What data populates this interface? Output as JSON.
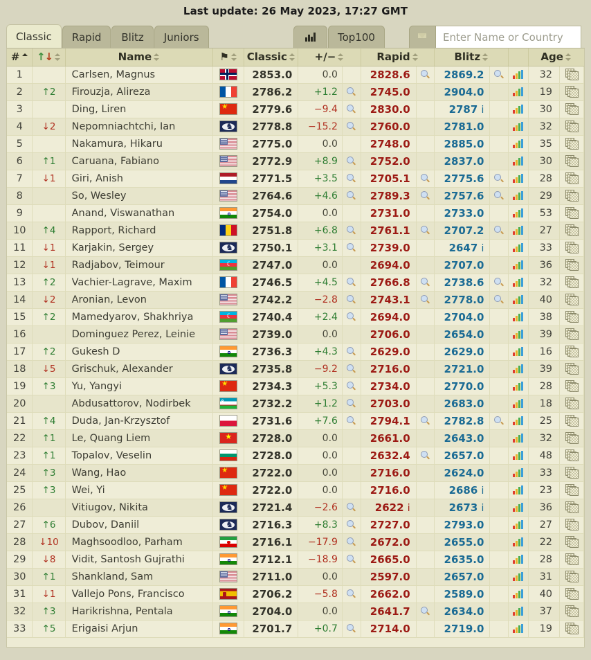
{
  "header": {
    "last_update": "Last update: 26 May 2023, 17:27 GMT"
  },
  "toolbar": {
    "tabs": [
      {
        "label": "Classic",
        "active": true
      },
      {
        "label": "Rapid",
        "active": false
      },
      {
        "label": "Blitz",
        "active": false
      },
      {
        "label": "Juniors",
        "active": false
      }
    ],
    "chart_button_icon": "bar-chart-icon",
    "top100_label": "Top100",
    "filter_icon": "funnel-icon",
    "search": {
      "value": "",
      "placeholder": "Enter Name or Country"
    }
  },
  "table": {
    "columns": [
      {
        "key": "rank",
        "label": "#",
        "sorted": "asc"
      },
      {
        "key": "change",
        "label": "↑↓"
      },
      {
        "key": "name",
        "label": "Name"
      },
      {
        "key": "flag",
        "label": "flag-icon"
      },
      {
        "key": "classic",
        "label": "Classic"
      },
      {
        "key": "diff",
        "label": "+/−"
      },
      {
        "key": "rapid",
        "label": "Rapid"
      },
      {
        "key": "blitz",
        "label": "Blitz"
      },
      {
        "key": "age",
        "label": "Age"
      }
    ],
    "rows": [
      {
        "rank": "1",
        "change": "",
        "dir": "",
        "name": "Carlsen, Magnus",
        "flag": "NOR",
        "classic": "2853.0",
        "diff": "0.0",
        "diff_sign": "zero",
        "classic_mag": false,
        "rapid": "2828.6",
        "rapid_i": false,
        "rapid_mag": true,
        "blitz": "2869.2",
        "blitz_i": false,
        "blitz_mag": true,
        "age": "32"
      },
      {
        "rank": "2",
        "change": "2",
        "dir": "up",
        "name": "Firouzja, Alireza",
        "flag": "FRA",
        "classic": "2786.2",
        "diff": "+1.2",
        "diff_sign": "pos",
        "classic_mag": true,
        "rapid": "2745.0",
        "rapid_i": false,
        "rapid_mag": false,
        "blitz": "2904.0",
        "blitz_i": false,
        "blitz_mag": false,
        "age": "19"
      },
      {
        "rank": "3",
        "change": "",
        "dir": "",
        "name": "Ding, Liren",
        "flag": "CHN",
        "classic": "2779.6",
        "diff": "−9.4",
        "diff_sign": "neg",
        "classic_mag": true,
        "rapid": "2830.0",
        "rapid_i": false,
        "rapid_mag": false,
        "blitz": "2787",
        "blitz_i": true,
        "blitz_mag": false,
        "age": "30"
      },
      {
        "rank": "4",
        "change": "2",
        "dir": "down",
        "name": "Nepomniachtchi, Ian",
        "flag": "FID",
        "classic": "2778.8",
        "diff": "−15.2",
        "diff_sign": "neg",
        "classic_mag": true,
        "rapid": "2760.0",
        "rapid_i": false,
        "rapid_mag": false,
        "blitz": "2781.0",
        "blitz_i": false,
        "blitz_mag": false,
        "age": "32"
      },
      {
        "rank": "5",
        "change": "",
        "dir": "",
        "name": "Nakamura, Hikaru",
        "flag": "USA",
        "classic": "2775.0",
        "diff": "0.0",
        "diff_sign": "zero",
        "classic_mag": false,
        "rapid": "2748.0",
        "rapid_i": false,
        "rapid_mag": false,
        "blitz": "2885.0",
        "blitz_i": false,
        "blitz_mag": false,
        "age": "35"
      },
      {
        "rank": "6",
        "change": "1",
        "dir": "up",
        "name": "Caruana, Fabiano",
        "flag": "USA",
        "classic": "2772.9",
        "diff": "+8.9",
        "diff_sign": "pos",
        "classic_mag": true,
        "rapid": "2752.0",
        "rapid_i": false,
        "rapid_mag": false,
        "blitz": "2837.0",
        "blitz_i": false,
        "blitz_mag": false,
        "age": "30"
      },
      {
        "rank": "7",
        "change": "1",
        "dir": "down",
        "name": "Giri, Anish",
        "flag": "NED",
        "classic": "2771.5",
        "diff": "+3.5",
        "diff_sign": "pos",
        "classic_mag": true,
        "rapid": "2705.1",
        "rapid_i": false,
        "rapid_mag": true,
        "blitz": "2775.6",
        "blitz_i": false,
        "blitz_mag": true,
        "age": "28"
      },
      {
        "rank": "8",
        "change": "",
        "dir": "",
        "name": "So, Wesley",
        "flag": "USA",
        "classic": "2764.6",
        "diff": "+4.6",
        "diff_sign": "pos",
        "classic_mag": true,
        "rapid": "2789.3",
        "rapid_i": false,
        "rapid_mag": true,
        "blitz": "2757.6",
        "blitz_i": false,
        "blitz_mag": true,
        "age": "29"
      },
      {
        "rank": "9",
        "change": "",
        "dir": "",
        "name": "Anand, Viswanathan",
        "flag": "IND",
        "classic": "2754.0",
        "diff": "0.0",
        "diff_sign": "zero",
        "classic_mag": false,
        "rapid": "2731.0",
        "rapid_i": false,
        "rapid_mag": false,
        "blitz": "2733.0",
        "blitz_i": false,
        "blitz_mag": false,
        "age": "53"
      },
      {
        "rank": "10",
        "change": "4",
        "dir": "up",
        "name": "Rapport, Richard",
        "flag": "ROU",
        "classic": "2751.8",
        "diff": "+6.8",
        "diff_sign": "pos",
        "classic_mag": true,
        "rapid": "2761.1",
        "rapid_i": false,
        "rapid_mag": true,
        "blitz": "2707.2",
        "blitz_i": false,
        "blitz_mag": true,
        "age": "27"
      },
      {
        "rank": "11",
        "change": "1",
        "dir": "down",
        "name": "Karjakin, Sergey",
        "flag": "FID",
        "classic": "2750.1",
        "diff": "+3.1",
        "diff_sign": "pos",
        "classic_mag": true,
        "rapid": "2739.0",
        "rapid_i": false,
        "rapid_mag": false,
        "blitz": "2647",
        "blitz_i": true,
        "blitz_mag": false,
        "age": "33"
      },
      {
        "rank": "12",
        "change": "1",
        "dir": "down",
        "name": "Radjabov, Teimour",
        "flag": "AZE",
        "classic": "2747.0",
        "diff": "0.0",
        "diff_sign": "zero",
        "classic_mag": false,
        "rapid": "2694.0",
        "rapid_i": false,
        "rapid_mag": false,
        "blitz": "2707.0",
        "blitz_i": false,
        "blitz_mag": false,
        "age": "36"
      },
      {
        "rank": "13",
        "change": "2",
        "dir": "up",
        "name": "Vachier-Lagrave, Maxim",
        "flag": "FRA",
        "classic": "2746.5",
        "diff": "+4.5",
        "diff_sign": "pos",
        "classic_mag": true,
        "rapid": "2766.8",
        "rapid_i": false,
        "rapid_mag": true,
        "blitz": "2738.6",
        "blitz_i": false,
        "blitz_mag": true,
        "age": "32"
      },
      {
        "rank": "14",
        "change": "2",
        "dir": "down",
        "name": "Aronian, Levon",
        "flag": "USA",
        "classic": "2742.2",
        "diff": "−2.8",
        "diff_sign": "neg",
        "classic_mag": true,
        "rapid": "2743.1",
        "rapid_i": false,
        "rapid_mag": true,
        "blitz": "2778.0",
        "blitz_i": false,
        "blitz_mag": true,
        "age": "40"
      },
      {
        "rank": "15",
        "change": "2",
        "dir": "up",
        "name": "Mamedyarov, Shakhriya",
        "flag": "AZE",
        "classic": "2740.4",
        "diff": "+2.4",
        "diff_sign": "pos",
        "classic_mag": true,
        "rapid": "2694.0",
        "rapid_i": false,
        "rapid_mag": false,
        "blitz": "2704.0",
        "blitz_i": false,
        "blitz_mag": false,
        "age": "38"
      },
      {
        "rank": "16",
        "change": "",
        "dir": "",
        "name": "Dominguez Perez, Leinie",
        "flag": "USA",
        "classic": "2739.0",
        "diff": "0.0",
        "diff_sign": "zero",
        "classic_mag": false,
        "rapid": "2706.0",
        "rapid_i": false,
        "rapid_mag": false,
        "blitz": "2654.0",
        "blitz_i": false,
        "blitz_mag": false,
        "age": "39"
      },
      {
        "rank": "17",
        "change": "2",
        "dir": "up",
        "name": "Gukesh D",
        "flag": "IND",
        "classic": "2736.3",
        "diff": "+4.3",
        "diff_sign": "pos",
        "classic_mag": true,
        "rapid": "2629.0",
        "rapid_i": false,
        "rapid_mag": false,
        "blitz": "2629.0",
        "blitz_i": false,
        "blitz_mag": false,
        "age": "16"
      },
      {
        "rank": "18",
        "change": "5",
        "dir": "down",
        "name": "Grischuk, Alexander",
        "flag": "FID",
        "classic": "2735.8",
        "diff": "−9.2",
        "diff_sign": "neg",
        "classic_mag": true,
        "rapid": "2716.0",
        "rapid_i": false,
        "rapid_mag": false,
        "blitz": "2721.0",
        "blitz_i": false,
        "blitz_mag": false,
        "age": "39"
      },
      {
        "rank": "19",
        "change": "3",
        "dir": "up",
        "name": "Yu, Yangyi",
        "flag": "CHN",
        "classic": "2734.3",
        "diff": "+5.3",
        "diff_sign": "pos",
        "classic_mag": true,
        "rapid": "2734.0",
        "rapid_i": false,
        "rapid_mag": false,
        "blitz": "2770.0",
        "blitz_i": false,
        "blitz_mag": false,
        "age": "28"
      },
      {
        "rank": "20",
        "change": "",
        "dir": "",
        "name": "Abdusattorov, Nodirbek",
        "flag": "UZB",
        "classic": "2732.2",
        "diff": "+1.2",
        "diff_sign": "pos",
        "classic_mag": true,
        "rapid": "2703.0",
        "rapid_i": false,
        "rapid_mag": false,
        "blitz": "2683.0",
        "blitz_i": false,
        "blitz_mag": false,
        "age": "18"
      },
      {
        "rank": "21",
        "change": "4",
        "dir": "up",
        "name": "Duda, Jan-Krzysztof",
        "flag": "POL",
        "classic": "2731.6",
        "diff": "+7.6",
        "diff_sign": "pos",
        "classic_mag": true,
        "rapid": "2794.1",
        "rapid_i": false,
        "rapid_mag": true,
        "blitz": "2782.8",
        "blitz_i": false,
        "blitz_mag": true,
        "age": "25"
      },
      {
        "rank": "22",
        "change": "1",
        "dir": "up",
        "name": "Le, Quang Liem",
        "flag": "VIE",
        "classic": "2728.0",
        "diff": "0.0",
        "diff_sign": "zero",
        "classic_mag": false,
        "rapid": "2661.0",
        "rapid_i": false,
        "rapid_mag": false,
        "blitz": "2643.0",
        "blitz_i": false,
        "blitz_mag": false,
        "age": "32"
      },
      {
        "rank": "23",
        "change": "1",
        "dir": "up",
        "name": "Topalov, Veselin",
        "flag": "BUL",
        "classic": "2728.0",
        "diff": "0.0",
        "diff_sign": "zero",
        "classic_mag": false,
        "rapid": "2632.4",
        "rapid_i": false,
        "rapid_mag": true,
        "blitz": "2657.0",
        "blitz_i": false,
        "blitz_mag": false,
        "age": "48"
      },
      {
        "rank": "24",
        "change": "3",
        "dir": "up",
        "name": "Wang, Hao",
        "flag": "CHN",
        "classic": "2722.0",
        "diff": "0.0",
        "diff_sign": "zero",
        "classic_mag": false,
        "rapid": "2716.0",
        "rapid_i": false,
        "rapid_mag": false,
        "blitz": "2624.0",
        "blitz_i": false,
        "blitz_mag": false,
        "age": "33"
      },
      {
        "rank": "25",
        "change": "3",
        "dir": "up",
        "name": "Wei, Yi",
        "flag": "CHN",
        "classic": "2722.0",
        "diff": "0.0",
        "diff_sign": "zero",
        "classic_mag": false,
        "rapid": "2716.0",
        "rapid_i": false,
        "rapid_mag": false,
        "blitz": "2686",
        "blitz_i": true,
        "blitz_mag": false,
        "age": "23"
      },
      {
        "rank": "26",
        "change": "",
        "dir": "",
        "name": "Vitiugov, Nikita",
        "flag": "FID",
        "classic": "2721.4",
        "diff": "−2.6",
        "diff_sign": "neg",
        "classic_mag": true,
        "rapid": "2622",
        "rapid_i": true,
        "rapid_mag": false,
        "blitz": "2673",
        "blitz_i": true,
        "blitz_mag": false,
        "age": "36"
      },
      {
        "rank": "27",
        "change": "6",
        "dir": "up",
        "name": "Dubov, Daniil",
        "flag": "FID",
        "classic": "2716.3",
        "diff": "+8.3",
        "diff_sign": "pos",
        "classic_mag": true,
        "rapid": "2727.0",
        "rapid_i": false,
        "rapid_mag": false,
        "blitz": "2793.0",
        "blitz_i": false,
        "blitz_mag": false,
        "age": "27"
      },
      {
        "rank": "28",
        "change": "10",
        "dir": "down",
        "name": "Maghsoodloo, Parham",
        "flag": "IRI",
        "classic": "2716.1",
        "diff": "−17.9",
        "diff_sign": "neg",
        "classic_mag": true,
        "rapid": "2672.0",
        "rapid_i": false,
        "rapid_mag": false,
        "blitz": "2655.0",
        "blitz_i": false,
        "blitz_mag": false,
        "age": "22"
      },
      {
        "rank": "29",
        "change": "8",
        "dir": "down",
        "name": "Vidit, Santosh Gujrathi",
        "flag": "IND",
        "classic": "2712.1",
        "diff": "−18.9",
        "diff_sign": "neg",
        "classic_mag": true,
        "rapid": "2665.0",
        "rapid_i": false,
        "rapid_mag": false,
        "blitz": "2635.0",
        "blitz_i": false,
        "blitz_mag": false,
        "age": "28"
      },
      {
        "rank": "30",
        "change": "1",
        "dir": "up",
        "name": "Shankland, Sam",
        "flag": "USA",
        "classic": "2711.0",
        "diff": "0.0",
        "diff_sign": "zero",
        "classic_mag": false,
        "rapid": "2597.0",
        "rapid_i": false,
        "rapid_mag": false,
        "blitz": "2657.0",
        "blitz_i": false,
        "blitz_mag": false,
        "age": "31"
      },
      {
        "rank": "31",
        "change": "1",
        "dir": "down",
        "name": "Vallejo Pons, Francisco",
        "flag": "ESP",
        "classic": "2706.2",
        "diff": "−5.8",
        "diff_sign": "neg",
        "classic_mag": true,
        "rapid": "2662.0",
        "rapid_i": false,
        "rapid_mag": false,
        "blitz": "2589.0",
        "blitz_i": false,
        "blitz_mag": false,
        "age": "40"
      },
      {
        "rank": "32",
        "change": "3",
        "dir": "up",
        "name": "Harikrishna, Pentala",
        "flag": "IND",
        "classic": "2704.0",
        "diff": "0.0",
        "diff_sign": "zero",
        "classic_mag": false,
        "rapid": "2641.7",
        "rapid_i": false,
        "rapid_mag": true,
        "blitz": "2634.0",
        "blitz_i": false,
        "blitz_mag": false,
        "age": "37"
      },
      {
        "rank": "33",
        "change": "5",
        "dir": "up",
        "name": "Erigaisi Arjun",
        "flag": "IND",
        "classic": "2701.7",
        "diff": "+0.7",
        "diff_sign": "pos",
        "classic_mag": true,
        "rapid": "2714.0",
        "rapid_i": false,
        "rapid_mag": false,
        "blitz": "2719.0",
        "blitz_i": false,
        "blitz_mag": false,
        "age": "19"
      }
    ]
  }
}
